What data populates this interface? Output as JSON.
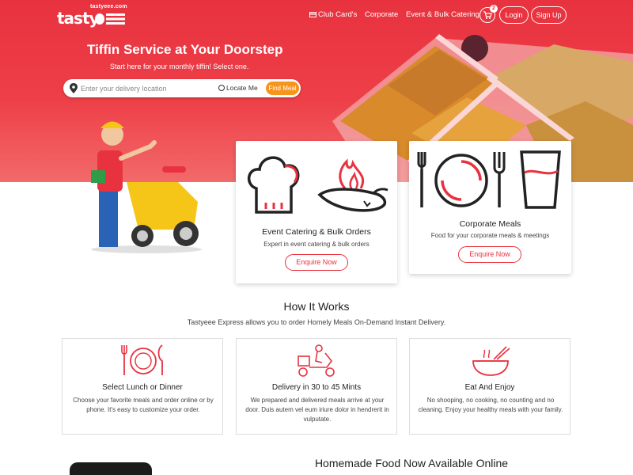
{
  "brand": {
    "logo_small": "tastyeee.com",
    "logo_main": "tasty"
  },
  "nav": {
    "club_cards": "Club Card's",
    "corporate": "Corporate",
    "event_catering": "Event & Bulk Catering",
    "cart_count": "2",
    "login": "Login",
    "signup": "Sign Up"
  },
  "hero": {
    "title": "Tiffin Service at Your Doorstep",
    "subtitle": "Start here for your monthly tiffin! Select one.",
    "search_placeholder": "Enter your delivery location",
    "locate_me": "Locate Me",
    "find_meal": "Find Meal"
  },
  "cards": {
    "event": {
      "title": "Event Catering & Bulk Orders",
      "desc": "Expert in event catering & bulk orders",
      "button": "Enquire Now"
    },
    "corporate": {
      "title": "Corporate Meals",
      "desc": "Food for your corporate meals & meetings",
      "button": "Enquire Now"
    }
  },
  "how_it_works": {
    "title": "How It Works",
    "subtitle": "Tastyeee Express allows you to order Homely Meals On-Demand Instant Delivery.",
    "steps": [
      {
        "title": "Select Lunch or Dinner",
        "desc": "Choose your favorite meals and order online or by phone. It's easy to customize your order.",
        "icon": "plate-cutlery-icon"
      },
      {
        "title": "Delivery in 30 to 45 Mints",
        "desc": "We prepared and delivered meals arrive at your door. Duis autem vel eum iriure dolor in hendrerit in vulputate.",
        "icon": "delivery-scooter-icon"
      },
      {
        "title": "Eat And Enjoy",
        "desc": "No shooping, no cooking, no counting and no cleaning. Enjoy your healthy meals with your family.",
        "icon": "noodle-bowl-icon"
      }
    ]
  },
  "homemade": {
    "title": "Homemade Food Now Available Online"
  },
  "colors": {
    "brand_red": "#e8323f",
    "accent_orange": "#f7941d"
  }
}
